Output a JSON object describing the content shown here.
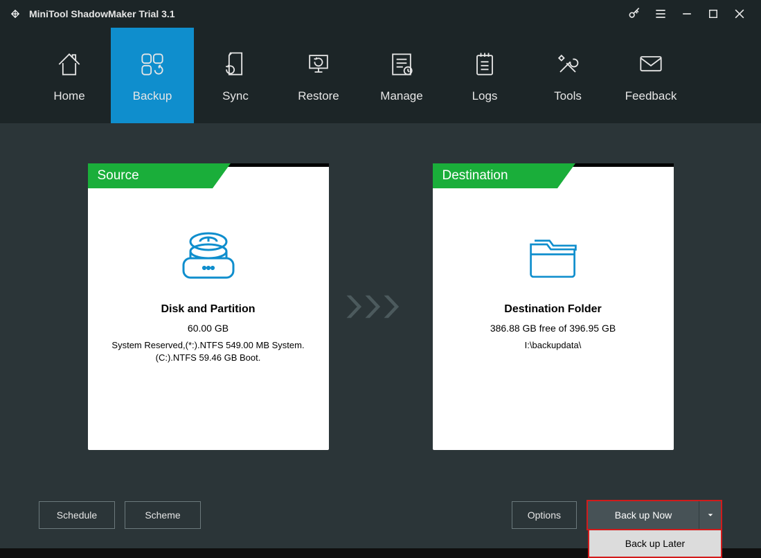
{
  "titlebar": {
    "title": "MiniTool ShadowMaker Trial 3.1"
  },
  "nav": {
    "items": [
      {
        "label": "Home"
      },
      {
        "label": "Backup"
      },
      {
        "label": "Sync"
      },
      {
        "label": "Restore"
      },
      {
        "label": "Manage"
      },
      {
        "label": "Logs"
      },
      {
        "label": "Tools"
      },
      {
        "label": "Feedback"
      }
    ]
  },
  "source": {
    "header": "Source",
    "heading": "Disk and Partition",
    "size": "60.00 GB",
    "details": "System Reserved,(*:).NTFS 549.00 MB System. (C:).NTFS 59.46 GB Boot."
  },
  "destination": {
    "header": "Destination",
    "heading": "Destination Folder",
    "free": "386.88 GB free of 396.95 GB",
    "path": "I:\\backupdata\\"
  },
  "footer": {
    "schedule": "Schedule",
    "scheme": "Scheme",
    "options": "Options",
    "backup_now": "Back up Now",
    "backup_later": "Back up Later"
  }
}
